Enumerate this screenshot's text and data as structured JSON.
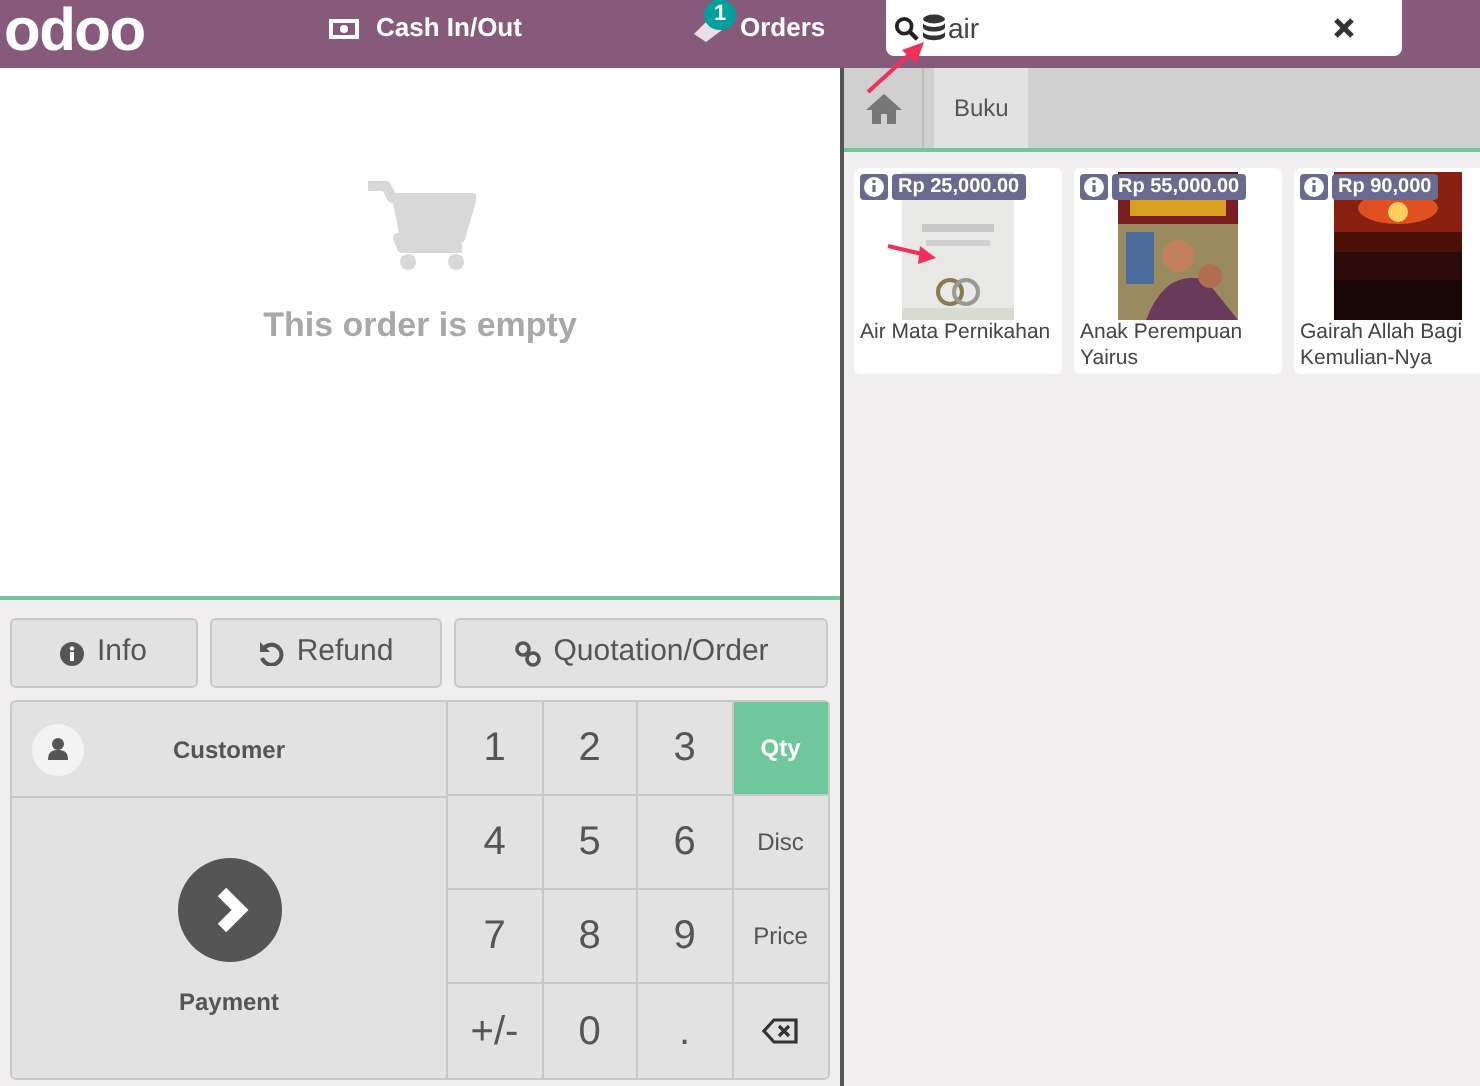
{
  "top_bar": {
    "logo": "odoo",
    "cash_button": "Cash In/Out",
    "orders_button": {
      "label": "Orders",
      "badge": "1"
    },
    "search": {
      "value": "air"
    }
  },
  "order": {
    "empty_message": "This order is empty"
  },
  "control_buttons": [
    {
      "label": "Info",
      "kind": "info"
    },
    {
      "label": "Refund",
      "kind": "refund"
    },
    {
      "label": "Quotation/Order",
      "kind": "link"
    }
  ],
  "customer_button": "Customer",
  "payment_button": "Payment",
  "numpad": [
    {
      "kind": "key",
      "label": "1"
    },
    {
      "kind": "key",
      "label": "2"
    },
    {
      "kind": "key",
      "label": "3"
    },
    {
      "kind": "mode",
      "label": "Qty",
      "selected": true
    },
    {
      "kind": "key",
      "label": "4"
    },
    {
      "kind": "key",
      "label": "5"
    },
    {
      "kind": "key",
      "label": "6"
    },
    {
      "kind": "mode",
      "label": "Disc",
      "selected": false
    },
    {
      "kind": "key",
      "label": "7"
    },
    {
      "kind": "key",
      "label": "8"
    },
    {
      "kind": "key",
      "label": "9"
    },
    {
      "kind": "mode",
      "label": "Price",
      "selected": false
    },
    {
      "kind": "key",
      "label": "+/-"
    },
    {
      "kind": "key",
      "label": "0"
    },
    {
      "kind": "key",
      "label": "."
    },
    {
      "kind": "backspace"
    }
  ],
  "categories": [
    {
      "label": "Buku"
    }
  ],
  "products": [
    {
      "price": "Rp 25,000.00",
      "name": "Air Mata Pernikahan",
      "kind": "picture"
    },
    {
      "price": "Rp 55,000.00",
      "name": "Anak Perempuan Yairus",
      "kind": "picture"
    },
    {
      "price": "Rp 90,000",
      "name": "Gairah Allah Bagi Kemulian-Nya",
      "kind": "picture"
    }
  ]
}
